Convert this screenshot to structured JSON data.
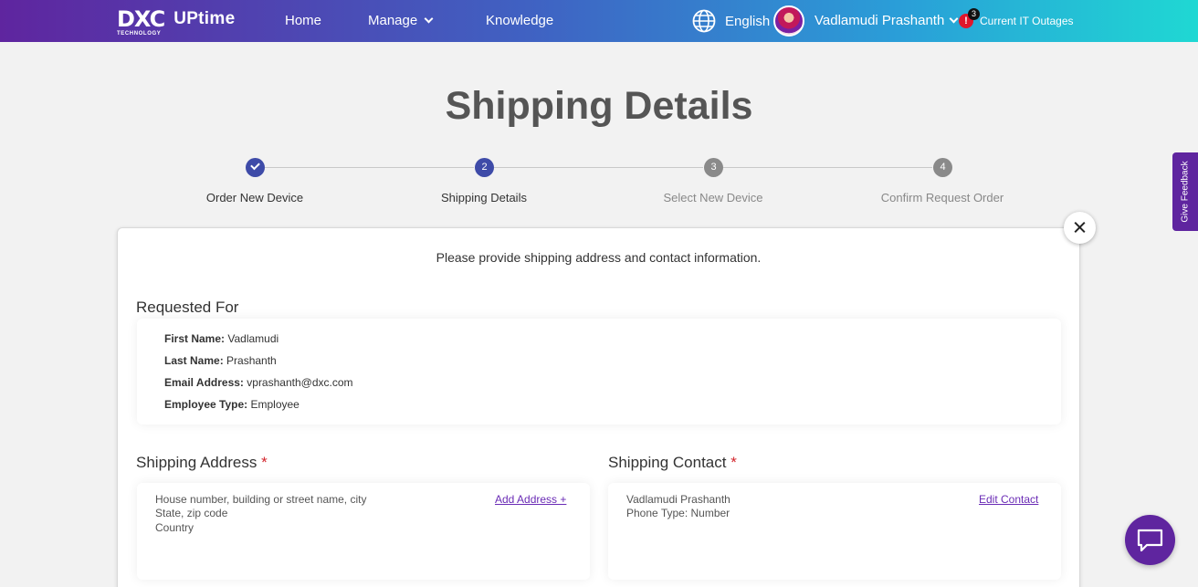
{
  "header": {
    "logo_mark": "DXC",
    "logo_sub": "TECHNOLOGY",
    "logo_product": "UPtime",
    "nav": [
      {
        "label": "Home"
      },
      {
        "label": "Manage"
      },
      {
        "label": "Knowledge"
      }
    ],
    "language": "English",
    "user_name": "Vadlamudi Prashanth",
    "alert_icon_text": "!",
    "alert_count": "3",
    "outages_label": "Current IT Outages"
  },
  "page": {
    "title": "Shipping Details"
  },
  "stepper": {
    "steps": [
      {
        "number": "1",
        "label": "Order New Device",
        "state": "done"
      },
      {
        "number": "2",
        "label": "Shipping Details",
        "state": "active"
      },
      {
        "number": "3",
        "label": "Select New Device",
        "state": "todo"
      },
      {
        "number": "4",
        "label": "Confirm Request Order",
        "state": "todo"
      }
    ]
  },
  "card": {
    "instruction": "Please provide shipping address and contact information.",
    "requested_for": {
      "title": "Requested For",
      "fields": [
        {
          "label": "First Name:",
          "value": "Vadlamudi"
        },
        {
          "label": "Last Name:",
          "value": "Prashanth"
        },
        {
          "label": "Email Address:",
          "value": "vprashanth@dxc.com"
        },
        {
          "label": "Employee Type:",
          "value": "Employee"
        }
      ]
    },
    "shipping_address": {
      "title": "Shipping Address",
      "required_mark": "*",
      "lines": [
        "House number, building or street name, city",
        "State, zip code",
        "Country"
      ],
      "action": "Add Address +"
    },
    "shipping_contact": {
      "title": "Shipping Contact",
      "required_mark": "*",
      "lines": [
        "Vadlamudi Prashanth",
        "Phone Type: Number"
      ],
      "action": "Edit Contact"
    }
  },
  "feedback_tab": "Give Feedback",
  "colors": {
    "brand_purple": "#5f259f",
    "step_active": "#3e4ba8",
    "step_inactive": "#8a8a8a",
    "required": "#d3262d",
    "link": "#6a2bb5"
  }
}
